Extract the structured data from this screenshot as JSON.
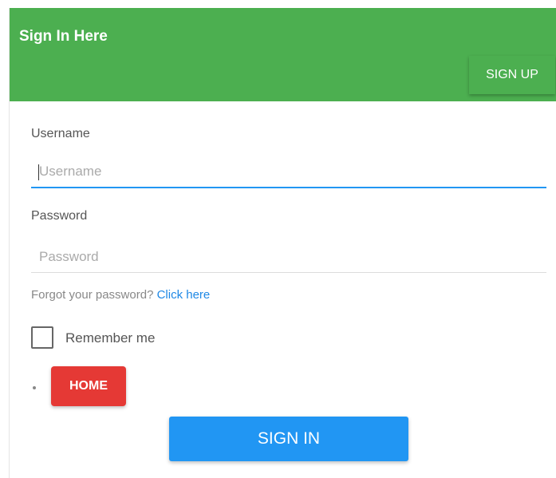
{
  "header": {
    "title": "Sign In Here",
    "signup_label": "SIGN UP"
  },
  "form": {
    "username_label": "Username",
    "username_placeholder": "Username",
    "password_label": "Password",
    "password_placeholder": "Password",
    "forgot_text": "Forgot your password?",
    "forgot_link": "Click here",
    "remember_label": "Remember me",
    "remember_checked": false,
    "home_label": "HOME",
    "signin_label": "SIGN IN"
  },
  "colors": {
    "header": "#4caf50",
    "primary": "#2196f3",
    "danger": "#e53935",
    "link": "#1e88e5"
  }
}
